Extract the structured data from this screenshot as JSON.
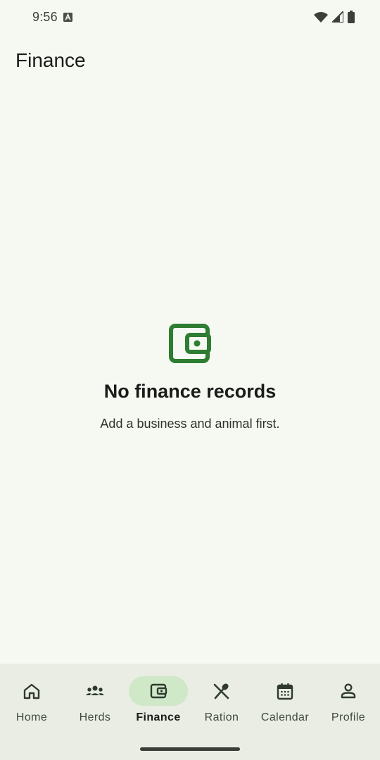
{
  "status_bar": {
    "time": "9:56",
    "left_icon": "a-notification-icon",
    "right_icons": [
      "wifi-icon",
      "signal-icon",
      "battery-icon"
    ]
  },
  "app_bar": {
    "title": "Finance"
  },
  "empty_state": {
    "icon": "wallet-icon",
    "icon_color": "#2e7d32",
    "title": "No finance records",
    "subtitle": "Add a business and animal first."
  },
  "bottom_nav": {
    "active_index": 2,
    "active_pill_color": "#cfe8c7",
    "items": [
      {
        "label": "Home",
        "icon": "home-icon"
      },
      {
        "label": "Herds",
        "icon": "group-icon"
      },
      {
        "label": "Finance",
        "icon": "wallet-icon"
      },
      {
        "label": "Ration",
        "icon": "utensils-icon"
      },
      {
        "label": "Calendar",
        "icon": "calendar-icon"
      },
      {
        "label": "Profile",
        "icon": "person-icon"
      }
    ]
  }
}
